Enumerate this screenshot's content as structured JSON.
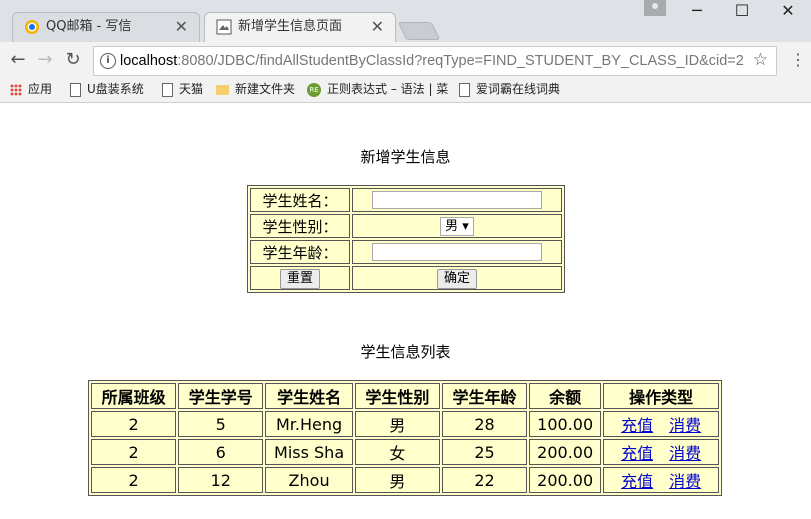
{
  "browser": {
    "tabs": [
      {
        "title": "QQ邮箱 - 写信",
        "icon": "qq-mail-icon"
      },
      {
        "title": "新增学生信息页面",
        "icon": "document-icon"
      }
    ],
    "window_controls": {
      "minimize": "─",
      "maximize": "☐",
      "close": "✕"
    },
    "url": {
      "host": "localhost",
      "rest": ":8080/JDBC/findAllStudentByClassId?reqType=FIND_STUDENT_BY_CLASS_ID&cid=2"
    },
    "bookmarks": [
      "应用",
      "U盘装系统",
      "天猫",
      "新建文件夹",
      "正则表达式 – 语法 | 菜",
      "爱词霸在线词典"
    ]
  },
  "form": {
    "title": "新增学生信息",
    "name_label": "学生姓名：",
    "gender_label": "学生性别：",
    "gender_selected": "男",
    "age_label": "学生年龄：",
    "reset_label": "重置",
    "submit_label": "确定"
  },
  "list": {
    "title": "学生信息列表",
    "headers": [
      "所属班级",
      "学生学号",
      "学生姓名",
      "学生性别",
      "学生年龄",
      "余额",
      "操作类型"
    ],
    "rows": [
      {
        "class": "2",
        "id": "5",
        "name": "Mr.Heng",
        "gender": "男",
        "age": "28",
        "balance": "100.00"
      },
      {
        "class": "2",
        "id": "6",
        "name": "Miss Sha",
        "gender": "女",
        "age": "25",
        "balance": "200.00"
      },
      {
        "class": "2",
        "id": "12",
        "name": "Zhou",
        "gender": "男",
        "age": "22",
        "balance": "200.00"
      }
    ],
    "action_recharge": "充值",
    "action_spend": "消费"
  }
}
